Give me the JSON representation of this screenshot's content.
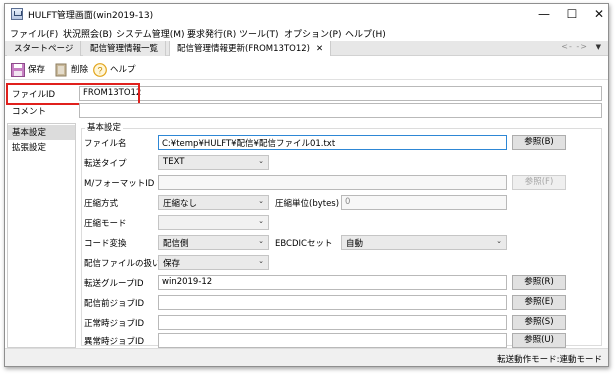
{
  "window": {
    "title": "HULFT管理画面(win2019-13)",
    "minimize": "—",
    "maximize": "☐",
    "close": "✕"
  },
  "menus": [
    "ファイル(F)",
    "状況照会(B)",
    "システム管理(M)",
    "要求発行(R)",
    "ツール(T)",
    "オプション(P)",
    "ヘルプ(H)"
  ],
  "tabs": {
    "items": [
      "スタートページ",
      "配信管理情報一覧",
      "配信管理情報更新(FROM13TO12)"
    ],
    "close": "✕",
    "nav": "<- ->",
    "dropdown": "▼"
  },
  "toolbar": {
    "save": "保存",
    "delete": "削除",
    "help": "ヘルプ",
    "help_glyph": "?"
  },
  "form": {
    "file_id_label": "ファイルID",
    "file_id_value": "FROM13TO12",
    "comment_label": "コメント",
    "comment_value": ""
  },
  "sidebar": {
    "items": [
      "基本設定",
      "拡張設定"
    ]
  },
  "basic": {
    "section_title": "基本設定",
    "file_name_label": "ファイル名",
    "file_name_value": "C:¥temp¥HULFT¥配信¥配信ファイル01.txt",
    "transfer_type_label": "転送タイプ",
    "transfer_type_value": "TEXT",
    "m_format_label": "M/フォーマットID",
    "compress_method_label": "圧縮方式",
    "compress_method_value": "圧縮なし",
    "compress_unit_label": "圧縮単位(bytes)",
    "compress_unit_value": "0",
    "compress_mode_label": "圧縮モード",
    "code_conv_label": "コード変換",
    "code_conv_value": "配信側",
    "ebcdic_label": "EBCDICセット",
    "ebcdic_value": "自動",
    "file_handling_label": "配信ファイルの扱い",
    "file_handling_value": "保存",
    "group_id_label": "転送グループID",
    "group_id_value": "win2019-12",
    "pre_job_label": "配信前ジョブID",
    "normal_job_label": "正常時ジョブID",
    "error_job_label": "異常時ジョブID",
    "ref_b": "参照(B)",
    "ref_f": "参照(F)",
    "ref_r": "参照(R)",
    "ref_e": "参照(E)",
    "ref_s": "参照(S)",
    "ref_u": "参照(U)",
    "arrow": "⌄"
  },
  "status": {
    "text": "転送動作モード:連動モード"
  },
  "colors": {
    "highlight_box": "#e0201c",
    "focus_border": "#2e87d5"
  }
}
